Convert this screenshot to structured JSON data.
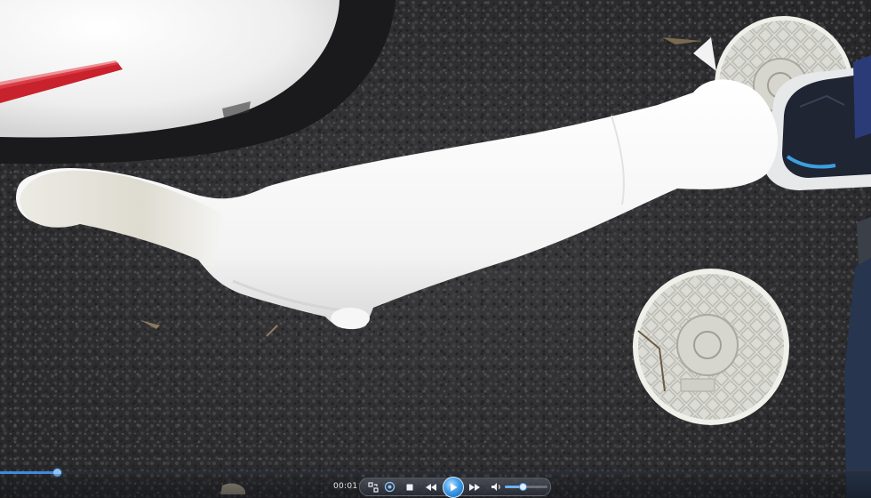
{
  "player": {
    "elapsed_time": "00:01",
    "progress": 0.065,
    "volume": 0.42,
    "state": "paused"
  },
  "controls": [
    {
      "name": "switch-to-library-button",
      "icon": "switch-view-icon"
    },
    {
      "name": "shuffle-button",
      "icon": "shuffle-icon"
    },
    {
      "name": "stop-button",
      "icon": "stop-icon"
    },
    {
      "name": "previous-button",
      "icon": "rewind-icon"
    },
    {
      "name": "play-button",
      "icon": "play-icon"
    },
    {
      "name": "next-button",
      "icon": "fast-forward-icon"
    },
    {
      "name": "mute-button",
      "icon": "speaker-icon"
    }
  ],
  "colors": {
    "accent": "#3d8be0",
    "asphalt": "#333335",
    "cat": "#f6f6f6",
    "manhole": "#d8d8d2"
  }
}
